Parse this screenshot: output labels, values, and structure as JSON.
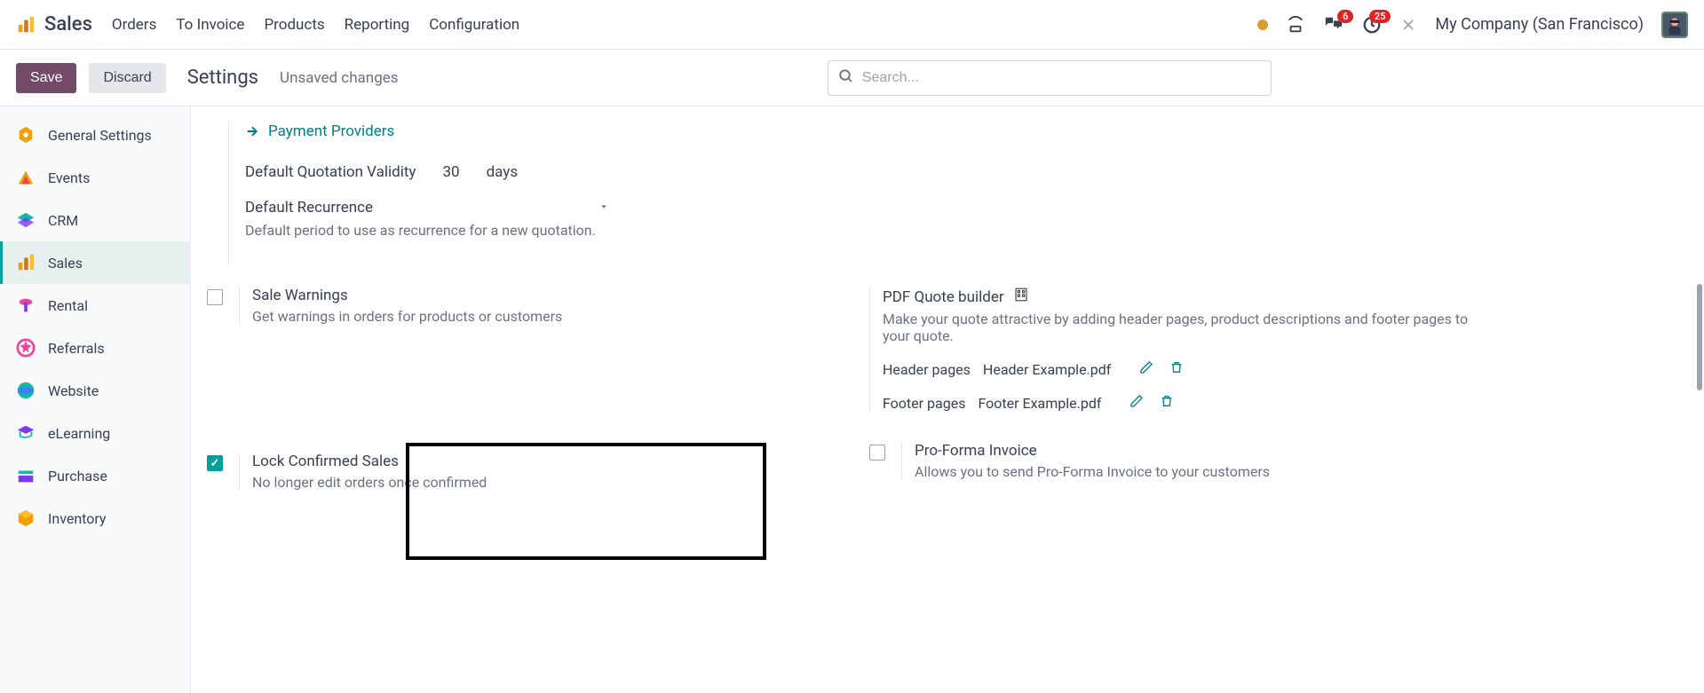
{
  "header": {
    "app": "Sales",
    "menu": [
      "Orders",
      "To Invoice",
      "Products",
      "Reporting",
      "Configuration"
    ],
    "msg_badge": "6",
    "act_badge": "25",
    "company": "My Company (San Francisco)"
  },
  "controlbar": {
    "save": "Save",
    "discard": "Discard",
    "title": "Settings",
    "unsaved": "Unsaved changes",
    "search_placeholder": "Search..."
  },
  "sidebar": {
    "items": [
      {
        "label": "General Settings"
      },
      {
        "label": "Events"
      },
      {
        "label": "CRM"
      },
      {
        "label": "Sales"
      },
      {
        "label": "Rental"
      },
      {
        "label": "Referrals"
      },
      {
        "label": "Website"
      },
      {
        "label": "eLearning"
      },
      {
        "label": "Purchase"
      },
      {
        "label": "Inventory"
      }
    ]
  },
  "content": {
    "payment_providers": "Payment Providers",
    "quotation_validity_label": "Default Quotation Validity",
    "quotation_validity_value": "30",
    "quotation_validity_unit": "days",
    "recurrence_label": "Default Recurrence",
    "recurrence_help": "Default period to use as recurrence for a new quotation.",
    "sale_warnings": {
      "title": "Sale Warnings",
      "desc": "Get warnings in orders for products or customers"
    },
    "lock_confirmed": {
      "title": "Lock Confirmed Sales",
      "desc": "No longer edit orders once confirmed"
    },
    "pdf_quote": {
      "title": "PDF Quote builder",
      "desc": "Make your quote attractive by adding header pages, product descriptions and footer pages to your quote.",
      "header_label": "Header pages",
      "header_file": "Header Example.pdf",
      "footer_label": "Footer pages",
      "footer_file": "Footer Example.pdf"
    },
    "proforma": {
      "title": "Pro-Forma Invoice",
      "desc": "Allows you to send Pro-Forma Invoice to your customers"
    }
  }
}
